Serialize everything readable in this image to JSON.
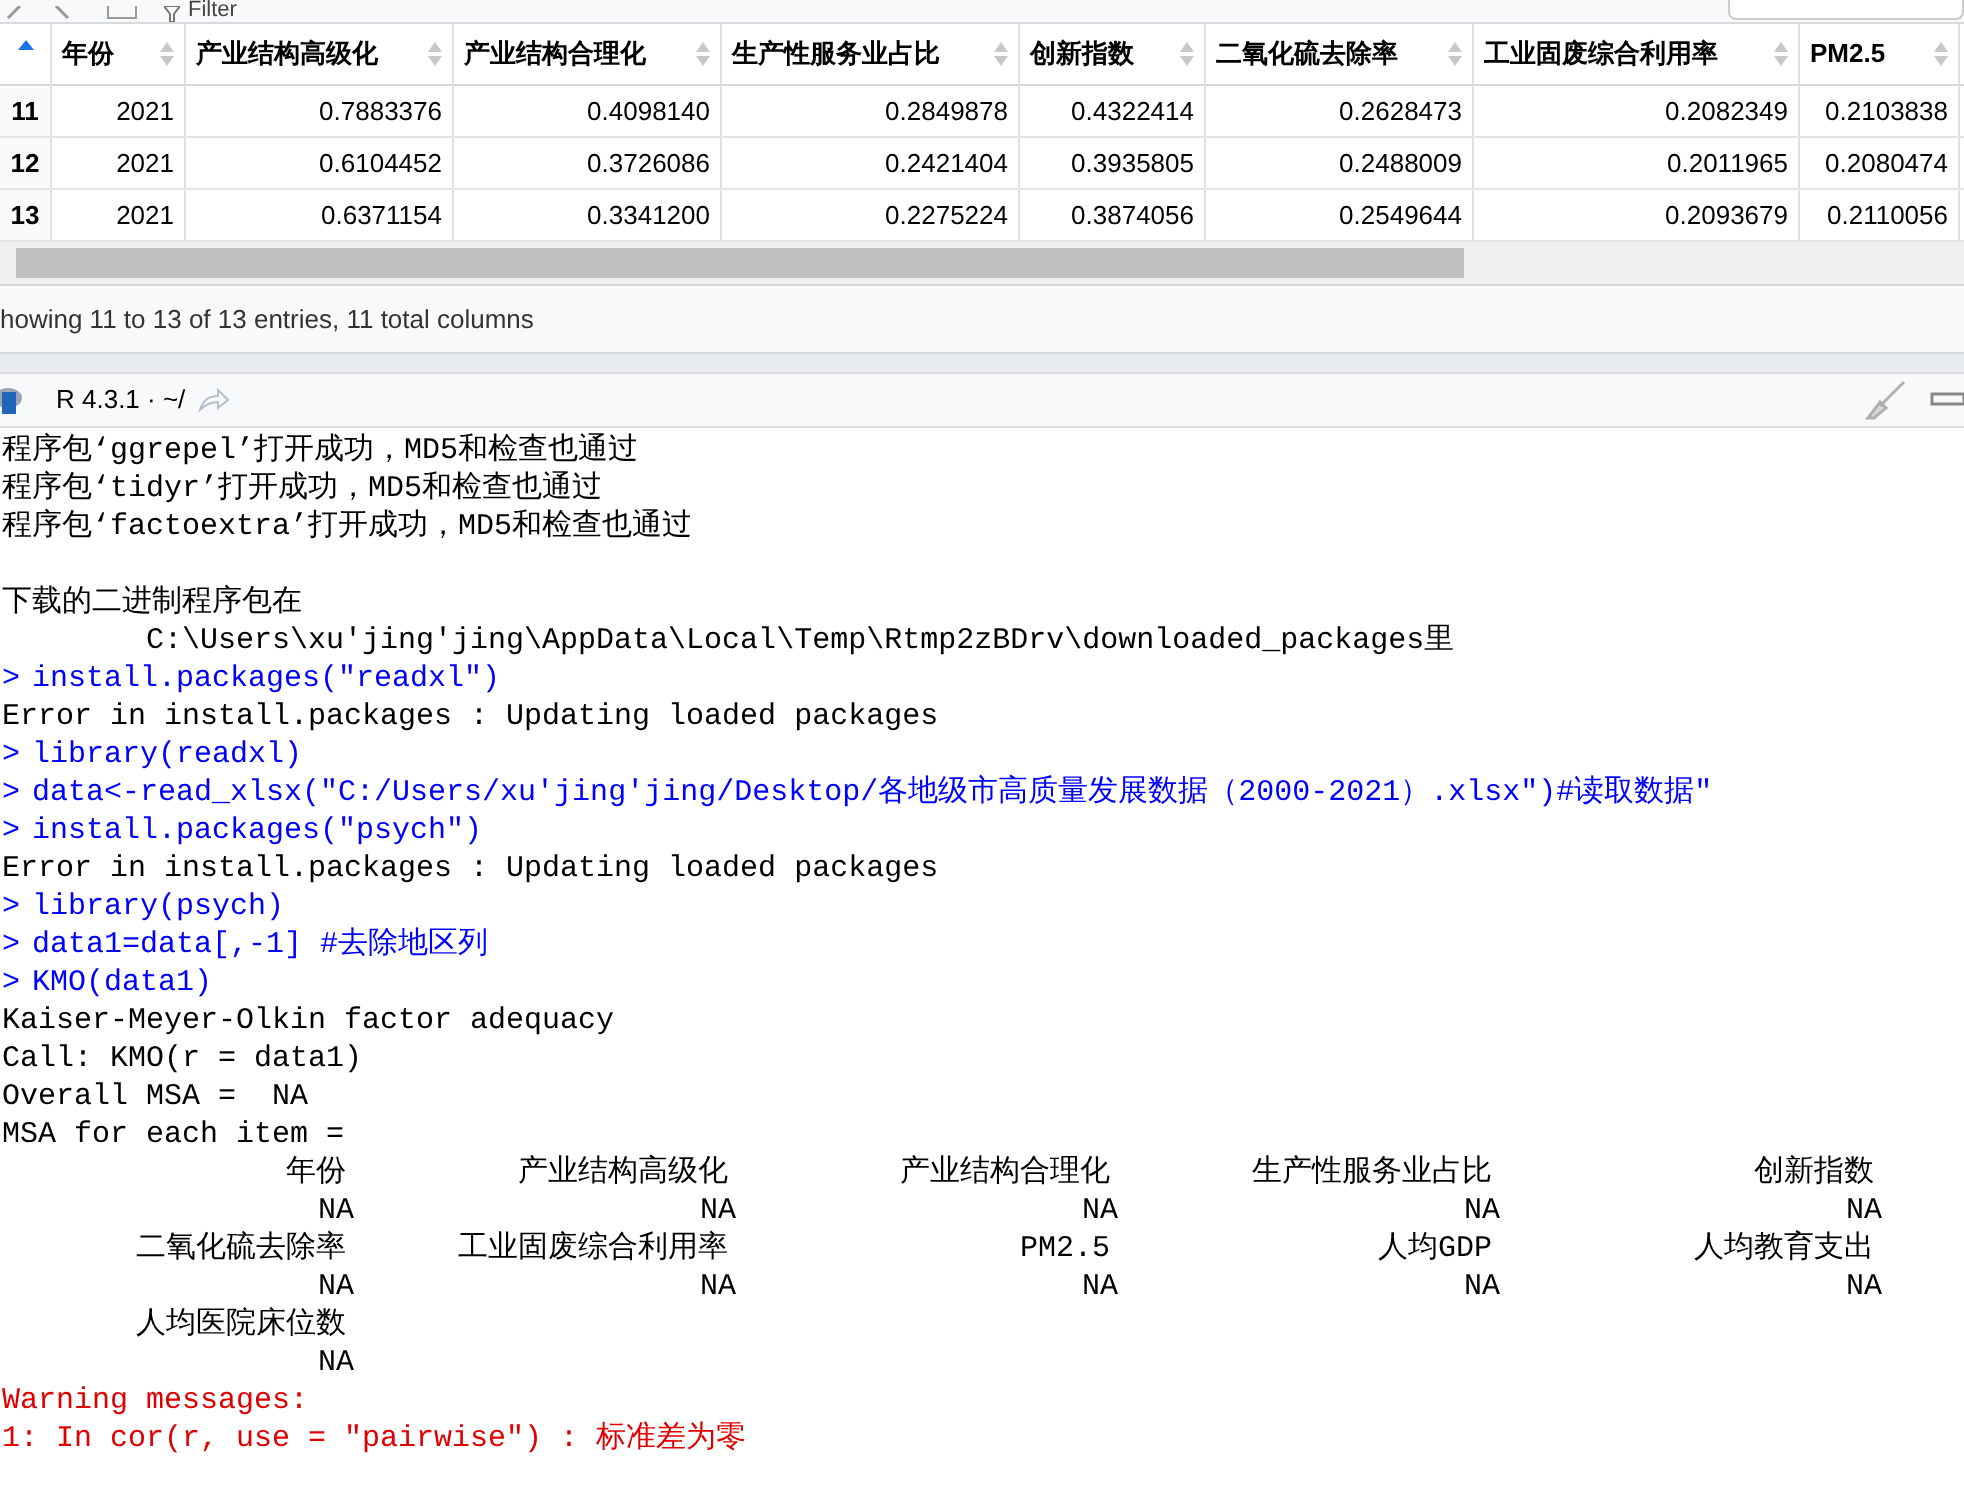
{
  "toolbar": {
    "filter_label": "Filter"
  },
  "table": {
    "columns": [
      "年份",
      "产业结构高级化",
      "产业结构合理化",
      "生产性服务业占比",
      "创新指数",
      "二氧化硫去除率",
      "工业固废综合利用率",
      "PM2.5"
    ],
    "rows": [
      {
        "index": "11",
        "cells": [
          "2021",
          "0.7883376",
          "0.4098140",
          "0.2849878",
          "0.4322414",
          "0.2628473",
          "0.2082349",
          "0.2103838"
        ]
      },
      {
        "index": "12",
        "cells": [
          "2021",
          "0.6104452",
          "0.3726086",
          "0.2421404",
          "0.3935805",
          "0.2488009",
          "0.2011965",
          "0.2080474"
        ]
      },
      {
        "index": "13",
        "cells": [
          "2021",
          "0.6371154",
          "0.3341200",
          "0.2275224",
          "0.3874056",
          "0.2549644",
          "0.2093679",
          "0.2110056"
        ]
      }
    ]
  },
  "table_status": "howing 11 to 13 of 13 entries, 11 total columns",
  "console": {
    "title": "R 4.3.1 · ~/",
    "lines": [
      {
        "kind": "output",
        "text": "程序包‘ggrepel’打开成功，MD5和检查也通过"
      },
      {
        "kind": "output",
        "text": "程序包‘tidyr’打开成功，MD5和检查也通过"
      },
      {
        "kind": "output",
        "text": "程序包‘factoextra’打开成功，MD5和检查也通过"
      },
      {
        "kind": "blank"
      },
      {
        "kind": "output",
        "text": "下载的二进制程序包在"
      },
      {
        "kind": "output",
        "text": "        C:\\Users\\xu'jing'jing\\AppData\\Local\\Temp\\Rtmp2zBDrv\\downloaded_packages里"
      },
      {
        "kind": "input",
        "text": "install.packages(\"readxl\")"
      },
      {
        "kind": "output",
        "text": "Error in install.packages : Updating loaded packages"
      },
      {
        "kind": "input",
        "text": "library(readxl)"
      },
      {
        "kind": "input",
        "text": "data<-read_xlsx(\"C:/Users/xu'jing'jing/Desktop/各地级市高质量发展数据（2000-2021）.xlsx\")#读取数据\""
      },
      {
        "kind": "input",
        "text": "install.packages(\"psych\")"
      },
      {
        "kind": "output",
        "text": "Error in install.packages : Updating loaded packages"
      },
      {
        "kind": "input",
        "text": "library(psych)"
      },
      {
        "kind": "input",
        "text": "data1=data[,-1] #去除地区列"
      },
      {
        "kind": "input",
        "text": "KMO(data1)"
      },
      {
        "kind": "output",
        "text": "Kaiser-Meyer-Olkin factor adequacy"
      },
      {
        "kind": "output",
        "text": "Call: KMO(r = data1)"
      },
      {
        "kind": "output",
        "text": "Overall MSA =  NA"
      },
      {
        "kind": "output",
        "text": "MSA for each item = "
      }
    ],
    "msa_rows": [
      {
        "names": [
          "年份",
          "产业结构高级化",
          "产业结构合理化",
          "生产性服务业占比",
          "创新指数"
        ],
        "values": [
          "NA",
          "NA",
          "NA",
          "NA",
          "NA"
        ]
      },
      {
        "names": [
          "二氧化硫去除率",
          "工业固废综合利用率",
          "PM2.5",
          "人均GDP",
          "人均教育支出"
        ],
        "values": [
          "NA",
          "NA",
          "NA",
          "NA",
          "NA"
        ]
      },
      {
        "names": [
          "人均医院床位数"
        ],
        "values": [
          "NA"
        ]
      }
    ],
    "trailing_lines": [
      {
        "kind": "warning",
        "text": "Warning messages:"
      },
      {
        "kind": "warning",
        "text": "1: In cor(r, use = \"pairwise\") : 标准差为零"
      }
    ],
    "prompt": ">"
  }
}
